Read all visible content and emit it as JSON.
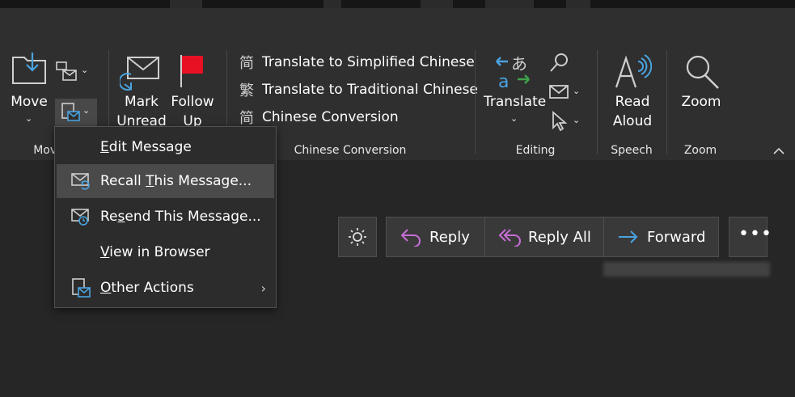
{
  "ribbon": {
    "move": {
      "label": "Move",
      "group_label": "Move"
    },
    "tags": {
      "mark_unread": "Mark Unread",
      "follow_up": "Follow Up"
    },
    "chinese": {
      "items": [
        {
          "glyph": "简",
          "label": "Translate to Simplified Chinese"
        },
        {
          "glyph": "繁",
          "label": "Translate to Traditional Chinese"
        },
        {
          "glyph": "简",
          "label": "Chinese Conversion"
        }
      ],
      "group_label": "Chinese Conversion"
    },
    "editing": {
      "translate": "Translate",
      "group_label": "Editing"
    },
    "speech": {
      "read_aloud": "Read Aloud",
      "group_label": "Speech"
    },
    "zoom": {
      "label": "Zoom",
      "group_label": "Zoom"
    }
  },
  "menu": {
    "items": [
      {
        "label": "Edit Message",
        "underline": "E",
        "icon": "none",
        "highlighted": false
      },
      {
        "label": "Recall This Message...",
        "underline": "T",
        "icon": "recall-message-icon",
        "highlighted": true
      },
      {
        "label": "Resend This Message...",
        "underline": "s",
        "icon": "resend-message-icon",
        "highlighted": false
      },
      {
        "label": "View in Browser",
        "underline": "V",
        "icon": "none",
        "highlighted": false
      },
      {
        "label": "Other Actions",
        "underline": "O",
        "icon": "other-actions-icon",
        "highlighted": false
      }
    ]
  },
  "reading": {
    "reply": "Reply",
    "reply_all": "Reply All",
    "forward": "Forward"
  },
  "colors": {
    "accent_blue": "#4aa3df",
    "flag_red": "#e81123",
    "reply_purple": "#c86dd7",
    "menu_highlight": "#4a4a4a"
  }
}
